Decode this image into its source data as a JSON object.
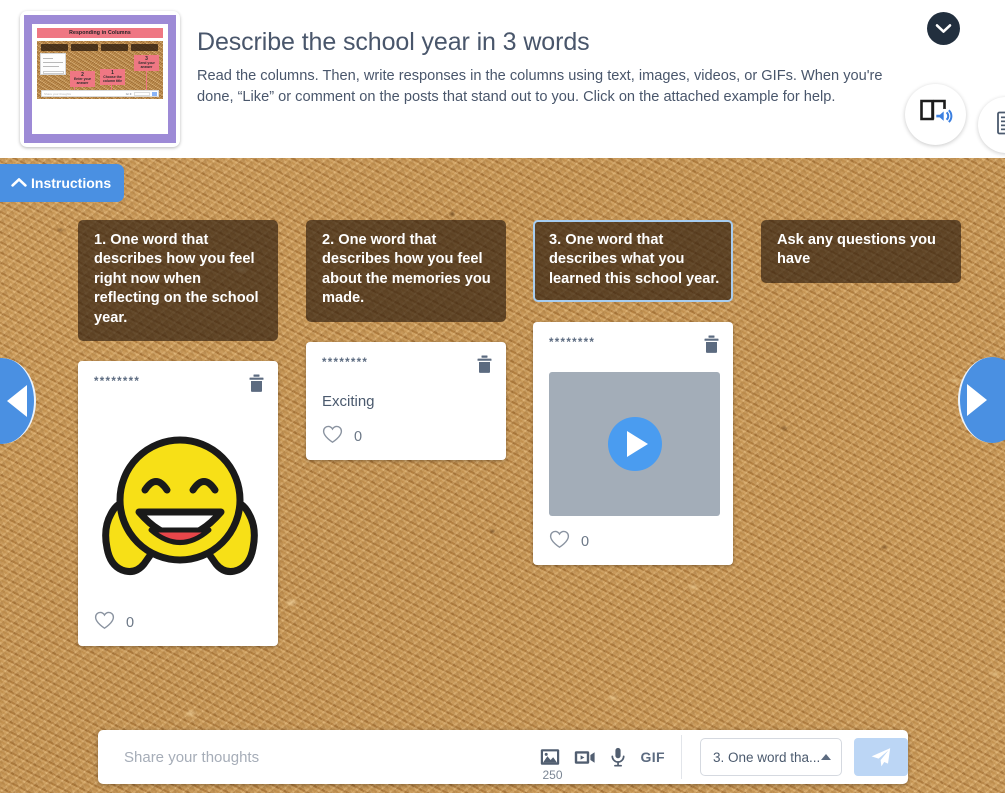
{
  "header": {
    "title": "Describe the school year in 3 words",
    "description": "Read the columns. Then, write responses in the columns using text, images, videos, or GIFs. When you're done, “Like” or comment on the posts that stand out to you. Click on the attached example for help.",
    "thumbnail": {
      "title": "Responding in Columns",
      "pins": [
        {
          "num": "2",
          "text": "Enter your answer"
        },
        {
          "num": "1",
          "text": "Choose the column title"
        },
        {
          "num": "3",
          "text": "Send your answer"
        }
      ],
      "composer_placeholder": "Share your thoughts",
      "composer_icons": "GIF"
    },
    "collapse_icon": "chevron-down-icon",
    "reader_icon": "immersive-reader-icon",
    "doc_icon": "document-list-icon"
  },
  "instructions_tab": {
    "label": "Instructions",
    "icon": "chevron-up-icon"
  },
  "nav": {
    "prev_icon": "arrow-left-icon",
    "next_icon": "arrow-right-icon"
  },
  "board": {
    "columns": [
      {
        "title": "1. One word that describes how you feel right now when reflecting on the school year.",
        "selected": false,
        "posts": [
          {
            "author": "********",
            "type": "image",
            "body": "",
            "media_alt": "grinning-face-with-thumbs-up-emoji",
            "likes": "0",
            "delete_icon": "trash-icon",
            "like_icon": "heart-icon"
          }
        ]
      },
      {
        "title": "2. One word that describes how you feel about the memories you made.",
        "selected": false,
        "posts": [
          {
            "author": "********",
            "type": "text",
            "body": "Exciting",
            "media_alt": "",
            "likes": "0",
            "delete_icon": "trash-icon",
            "like_icon": "heart-icon"
          }
        ]
      },
      {
        "title": "3. One word that describes what you learned this school year.",
        "selected": true,
        "posts": [
          {
            "author": "********",
            "type": "video",
            "body": "",
            "media_alt": "video-thumbnail-placeholder",
            "likes": "0",
            "delete_icon": "trash-icon",
            "like_icon": "heart-icon"
          }
        ]
      },
      {
        "title": "Ask any questions you have",
        "selected": false,
        "posts": []
      }
    ]
  },
  "composer": {
    "placeholder": "Share your thoughts",
    "value": "",
    "char_count": "250",
    "tools": [
      {
        "name": "image-icon",
        "label": ""
      },
      {
        "name": "video-icon",
        "label": ""
      },
      {
        "name": "microphone-icon",
        "label": ""
      },
      {
        "name": "gif-icon",
        "label": "GIF"
      }
    ],
    "column_select": {
      "value": "3. One word tha...",
      "caret_icon": "caret-up-icon"
    },
    "send_icon": "send-paper-plane-icon"
  },
  "colors": {
    "accent_blue": "#4a90e2",
    "cork": "#c79856",
    "column_header_bg": "rgba(44,28,14,0.66)",
    "text_slate": "#49566b",
    "send_button": "#bcd6f5",
    "play_button": "#4a9cf0"
  }
}
